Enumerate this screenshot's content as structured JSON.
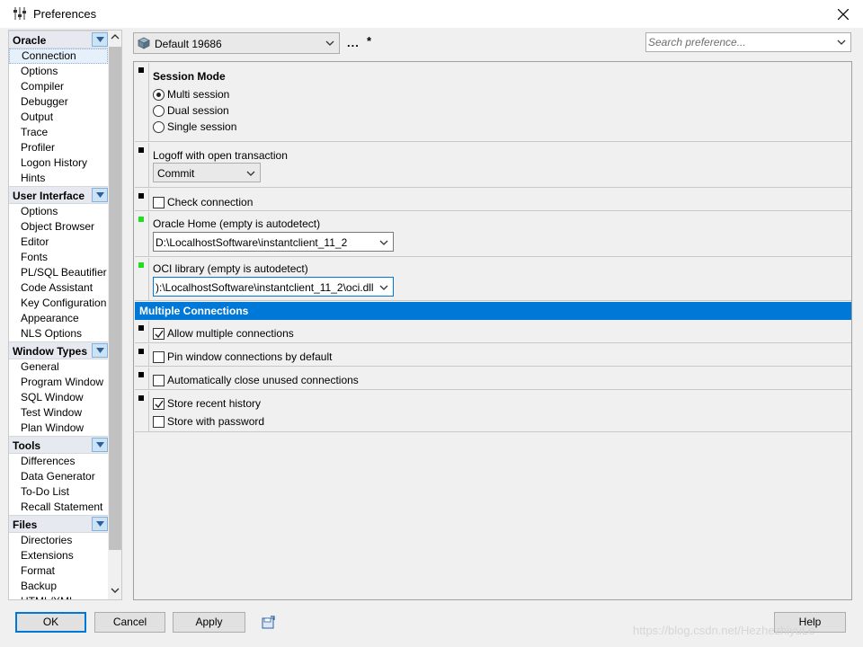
{
  "window": {
    "title": "Preferences"
  },
  "nav": [
    {
      "header": "Oracle",
      "items": [
        "Connection",
        "Options",
        "Compiler",
        "Debugger",
        "Output",
        "Trace",
        "Profiler",
        "Logon History",
        "Hints"
      ]
    },
    {
      "header": "User Interface",
      "items": [
        "Options",
        "Object Browser",
        "Editor",
        "Fonts",
        "PL/SQL Beautifier",
        "Code Assistant",
        "Key Configuration",
        "Appearance",
        "NLS Options"
      ]
    },
    {
      "header": "Window Types",
      "items": [
        "General",
        "Program Window",
        "SQL Window",
        "Test Window",
        "Plan Window"
      ]
    },
    {
      "header": "Tools",
      "items": [
        "Differences",
        "Data Generator",
        "To-Do List",
        "Recall Statement"
      ]
    },
    {
      "header": "Files",
      "items": [
        "Directories",
        "Extensions",
        "Format",
        "Backup",
        "HTML/XML"
      ]
    }
  ],
  "nav_selected": "Connection",
  "toolbar": {
    "profile": "Default 19686",
    "more_label": "...",
    "modified_mark": "*",
    "search_placeholder": "Search preference..."
  },
  "settings": {
    "session_mode": {
      "title": "Session Mode",
      "options": [
        {
          "label": "Multi session",
          "selected": true
        },
        {
          "label": "Dual session",
          "selected": false
        },
        {
          "label": "Single session",
          "selected": false
        }
      ]
    },
    "logoff": {
      "label": "Logoff with open transaction",
      "value": "Commit"
    },
    "check_connection": {
      "label": "Check connection",
      "checked": false
    },
    "oracle_home": {
      "label": "Oracle Home (empty is autodetect)",
      "value": "D:\\LocalhostSoftware\\instantclient_11_2"
    },
    "oci_library": {
      "label": "OCI library (empty is autodetect)",
      "value": "):\\LocalhostSoftware\\instantclient_11_2\\oci.dll"
    },
    "multiple_connections": {
      "title": "Multiple Connections",
      "allow_multiple": {
        "label": "Allow multiple connections",
        "checked": true
      },
      "pin_window": {
        "label": "Pin window connections by default",
        "checked": false
      },
      "auto_close": {
        "label": "Automatically close unused connections",
        "checked": false
      },
      "store_history": {
        "label": "Store recent history",
        "checked": true
      },
      "store_password": {
        "label": "Store with password",
        "checked": false
      }
    }
  },
  "buttons": {
    "ok": "OK",
    "cancel": "Cancel",
    "apply": "Apply",
    "help": "Help"
  },
  "watermark": "https://blog.csdn.net/HezhezhiyuLe",
  "colors": {
    "accent": "#0078d7",
    "modified_marker": "#22dd22"
  }
}
